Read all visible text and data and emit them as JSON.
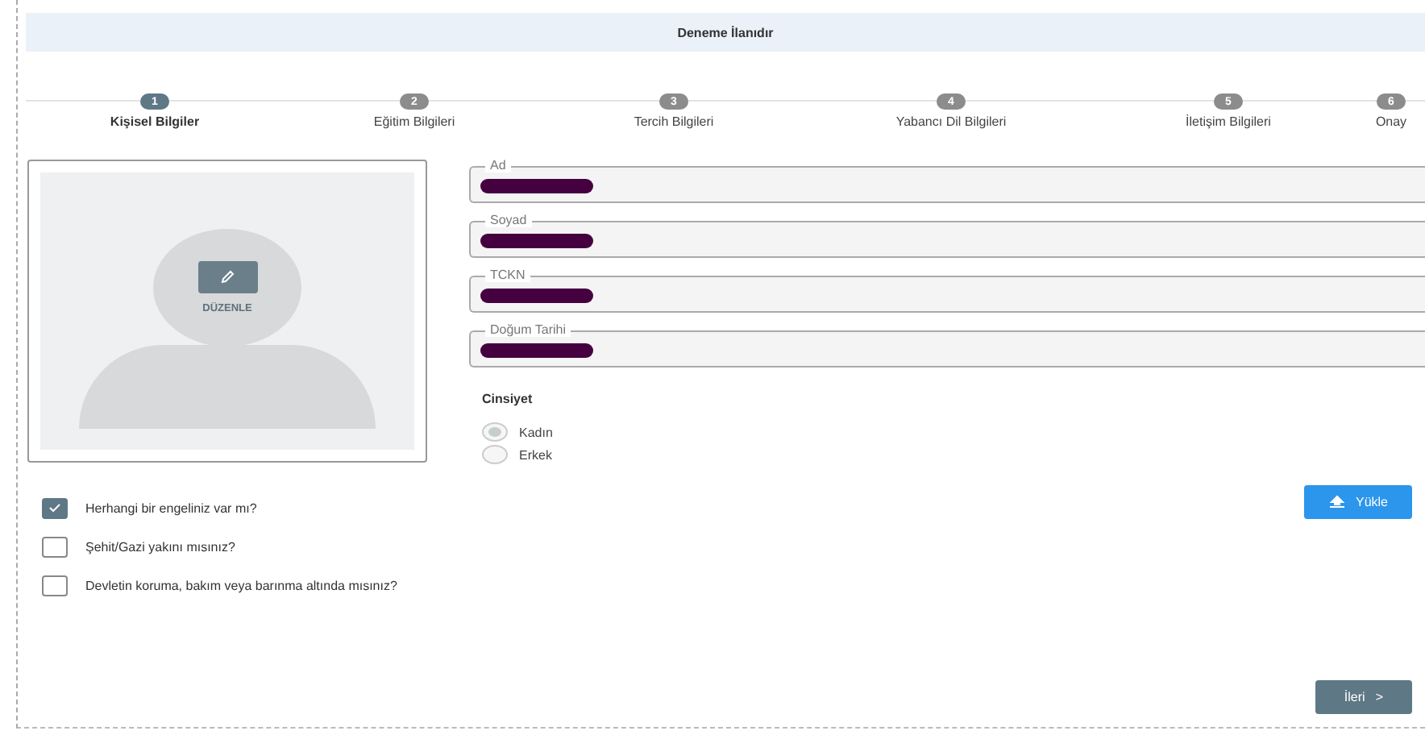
{
  "header": {
    "title": "Deneme İlanıdır"
  },
  "steps": [
    {
      "number": "1",
      "label": "Kişisel Bilgiler",
      "selected": true
    },
    {
      "number": "2",
      "label": "Eğitim Bilgileri",
      "selected": false
    },
    {
      "number": "3",
      "label": "Tercih Bilgileri",
      "selected": false
    },
    {
      "number": "4",
      "label": "Yabancı Dil Bilgileri",
      "selected": false
    },
    {
      "number": "5",
      "label": "İletişim Bilgileri",
      "selected": false
    },
    {
      "number": "6",
      "label": "Onay",
      "selected": false
    }
  ],
  "photo": {
    "edit_label": "DÜZENLE"
  },
  "fields": [
    {
      "label": "Ad",
      "redacted": true
    },
    {
      "label": "Soyad",
      "redacted": true
    },
    {
      "label": "TCKN",
      "redacted": true
    },
    {
      "label": "Doğum Tarihi",
      "redacted": true
    }
  ],
  "gender": {
    "label": "Cinsiyet",
    "options": [
      {
        "label": "Kadın",
        "selected": true
      },
      {
        "label": "Erkek",
        "selected": false
      }
    ]
  },
  "questions": [
    {
      "label": "Herhangi bir engeliniz var mı?",
      "checked": true
    },
    {
      "label": "Şehit/Gazi yakını mısınız?",
      "checked": false
    },
    {
      "label": "Devletin koruma, bakım veya barınma altında mısınız?",
      "checked": false
    }
  ],
  "upload_button": "Yükle",
  "next_button": {
    "label": "İleri",
    "arrow": ">"
  }
}
